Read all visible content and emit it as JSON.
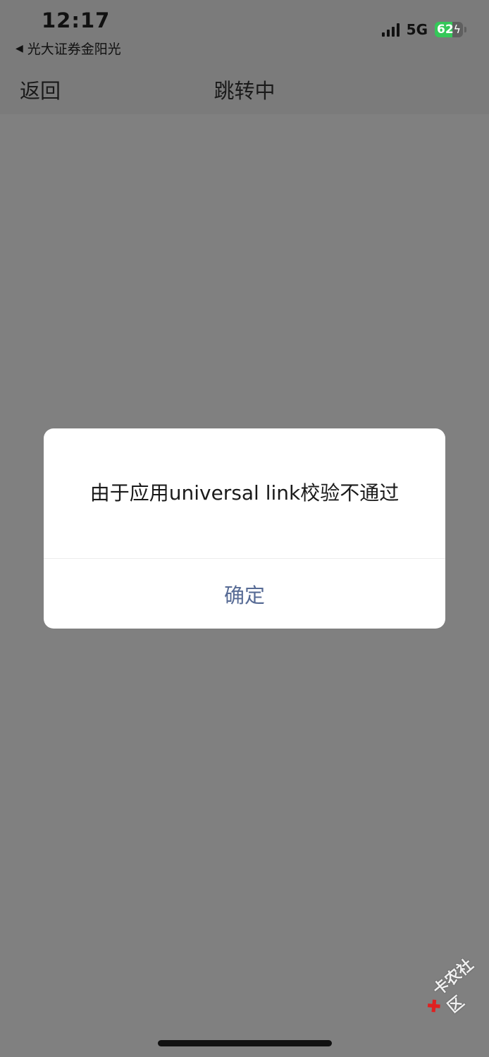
{
  "status_bar": {
    "time": "12:17",
    "back_app": "光大证券金阳光",
    "back_arrow": "◀",
    "network": "5G",
    "battery_percent": "62",
    "battery_level": 0.62,
    "battery_icon": "bolt-icon",
    "colors": {
      "battery_fill": "#35c759"
    }
  },
  "nav": {
    "back_label": "返回",
    "title": "跳转中"
  },
  "dialog": {
    "message": "由于应用universal link校验不通过",
    "confirm_label": "确定",
    "colors": {
      "confirm": "#576b95"
    }
  },
  "watermark": {
    "text": "卡农社区"
  }
}
